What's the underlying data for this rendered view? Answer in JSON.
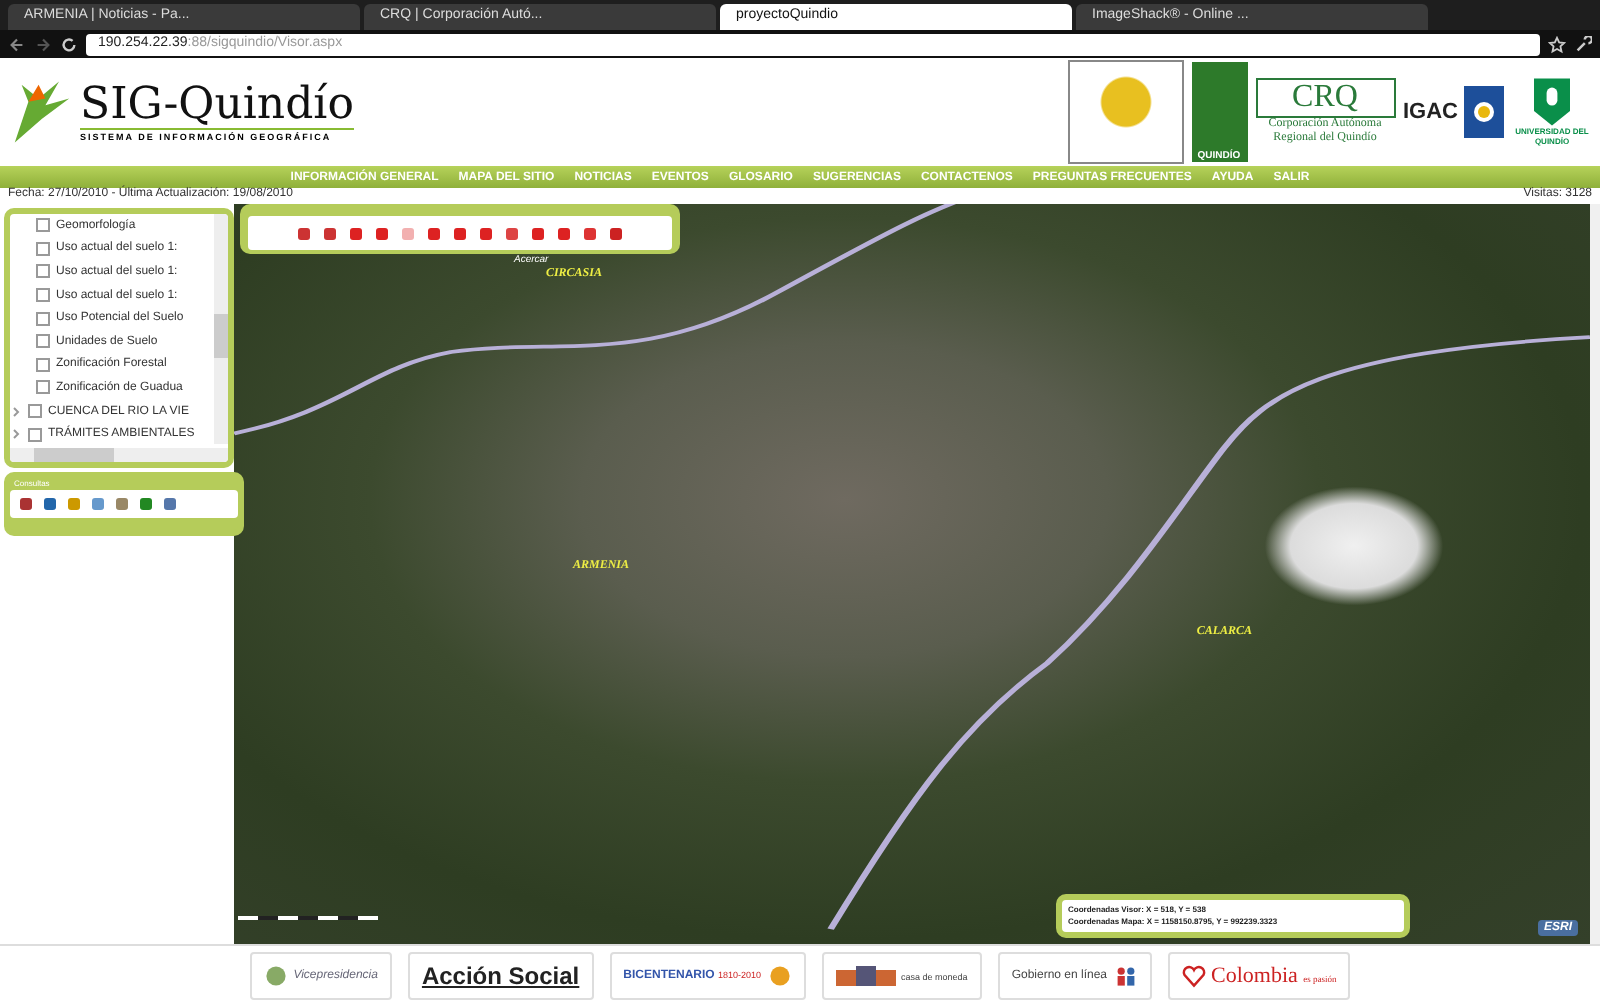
{
  "browser": {
    "tabs": [
      {
        "label": "ARMENIA | Noticias - Pa...",
        "selected": false
      },
      {
        "label": "CRQ | Corporación Autó...",
        "selected": false
      },
      {
        "label": "proyectoQuindio",
        "selected": true
      },
      {
        "label": "ImageShack® - Online ...",
        "selected": false
      }
    ],
    "address": {
      "host": "190.254.22.39",
      "path": ":88/sigquindio/Visor.aspx"
    }
  },
  "header": {
    "logo_title": "SIG-Quindío",
    "logo_subtitle": "SISTEMA DE INFORMACIÓN GEOGRÁFICA",
    "partners": [
      {
        "kind": "seal",
        "label": "QUINDÍO"
      },
      {
        "kind": "text",
        "title": "CRQ",
        "label": "Corporación Autónoma Regional del Quindío"
      },
      {
        "kind": "igac",
        "title": "IGAC"
      },
      {
        "kind": "uni",
        "label": "UNIVERSIDAD DEL QUINDÍO"
      }
    ]
  },
  "nav": [
    "INFORMACIÓN GENERAL",
    "MAPA DEL SITIO",
    "NOTICIAS",
    "EVENTOS",
    "GLOSARIO",
    "SUGERENCIAS",
    "CONTACTENOS",
    "PREGUNTAS FRECUENTES",
    "AYUDA",
    "SALIR"
  ],
  "info": {
    "dates": "Fecha: 27/10/2010 - Última Actualización: 19/08/2010",
    "visits": "Visitas:  3128"
  },
  "layers": [
    {
      "kind": "layer",
      "label": "Geomorfología",
      "checked": false
    },
    {
      "kind": "layer",
      "label": "Uso actual del suelo 1:",
      "checked": false
    },
    {
      "kind": "layer",
      "label": "Uso actual del suelo 1:",
      "checked": false
    },
    {
      "kind": "layer",
      "label": "Uso actual del suelo 1:",
      "checked": false
    },
    {
      "kind": "layer",
      "label": "Uso Potencial del Suelo",
      "checked": false
    },
    {
      "kind": "layer",
      "label": "Unidades de Suelo",
      "checked": false
    },
    {
      "kind": "layer",
      "label": "Zonificación Forestal",
      "checked": false
    },
    {
      "kind": "layer",
      "label": "Zonificación de Guadua",
      "checked": false
    },
    {
      "kind": "group",
      "label": "CUENCA DEL RIO LA VIE",
      "checked": false
    },
    {
      "kind": "group",
      "label": "TRÁMITES AMBIENTALES",
      "checked": false
    }
  ],
  "consultas": {
    "title": "Consultas"
  },
  "map": {
    "tooltip": "Acercar",
    "labels": [
      "CIRCASIA",
      "ARMENIA",
      "CALARCA"
    ],
    "coords": [
      "Coordenadas Visor: X = 518, Y = 538",
      "Coordenadas Mapa: X = 1158150.8795, Y = 992239.3323"
    ],
    "esri": "ESRI"
  },
  "footer": [
    {
      "kind": "plain",
      "label": "Vicepresidencia"
    },
    {
      "kind": "bold",
      "label": "Acción Social"
    },
    {
      "kind": "bicentenario",
      "label": "BICENTENARIO",
      "sub": "1810-2010"
    },
    {
      "kind": "museum",
      "label": "casa de moneda"
    },
    {
      "kind": "portal",
      "label": "Gobierno en línea"
    },
    {
      "kind": "colombia",
      "label": "Colombia",
      "sub": "es pasión"
    }
  ]
}
